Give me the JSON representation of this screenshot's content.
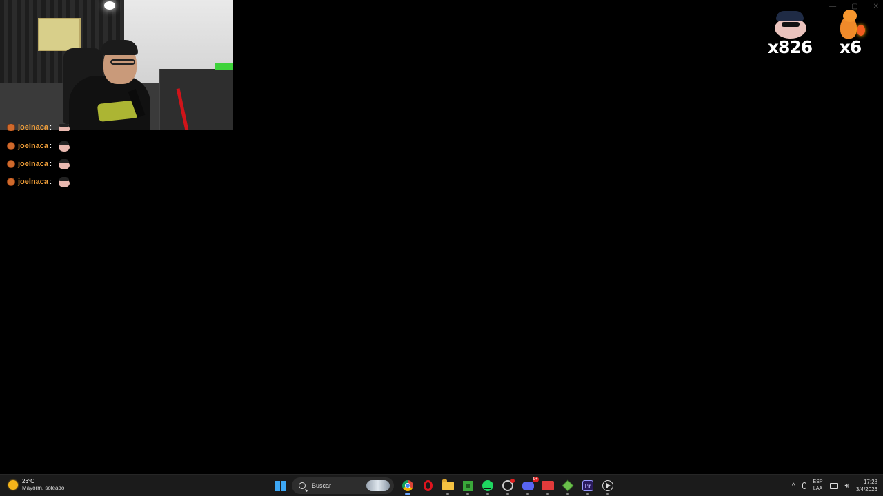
{
  "chat": {
    "messages": [
      {
        "user": "joelnaca",
        "separator": ":",
        "emote": "pepe-cap-emote"
      },
      {
        "user": "joelnaca",
        "separator": ":",
        "emote": "pepe-cap-emote"
      },
      {
        "user": "joelnaca",
        "separator": ":",
        "emote": "pepe-cap-emote"
      },
      {
        "user": "joelnaca",
        "separator": ":",
        "emote": "pepe-cap-emote"
      }
    ]
  },
  "counters": {
    "pepe": {
      "count": "x826",
      "icon": "pepe-cap-emote"
    },
    "charmander": {
      "count": "x6",
      "icon": "charmander-emote"
    }
  },
  "taskbar": {
    "weather": {
      "temp": "26°C",
      "condition": "Mayorm. soleado",
      "icon": "sun-icon"
    },
    "search_placeholder": "Buscar",
    "apps": [
      {
        "name": "start",
        "icon": "windows-icon"
      },
      {
        "name": "chrome",
        "icon": "chrome-icon",
        "state": "active"
      },
      {
        "name": "opera",
        "icon": "opera-icon"
      },
      {
        "name": "file-explorer",
        "icon": "folder-icon",
        "state": "open"
      },
      {
        "name": "minecraft",
        "icon": "minecraft-icon",
        "state": "open"
      },
      {
        "name": "spotify",
        "icon": "spotify-icon",
        "state": "open"
      },
      {
        "name": "steam",
        "icon": "steam-icon",
        "state": "open"
      },
      {
        "name": "discord",
        "icon": "discord-icon",
        "state": "open",
        "badge": "9+"
      },
      {
        "name": "obs",
        "icon": "obs-icon",
        "state": "open"
      },
      {
        "name": "block-app",
        "icon": "green-block-icon",
        "state": "open"
      },
      {
        "name": "premiere",
        "icon": "premiere-icon",
        "label": "Pr",
        "state": "open"
      },
      {
        "name": "media-player",
        "icon": "media-play-icon",
        "state": "open"
      }
    ],
    "tray": {
      "language_top": "ESP",
      "language_bottom": "LAA",
      "time": "17:28",
      "date": "3/4/2026"
    }
  },
  "colors": {
    "chat_username": "#f2a03a",
    "accent": "#6aa6ff",
    "taskbar_bg": "#1b1b1b"
  }
}
